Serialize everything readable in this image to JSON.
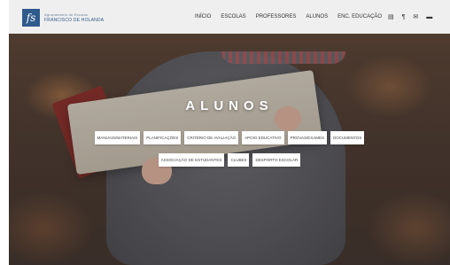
{
  "header": {
    "logo_letter": "fs",
    "logo_line1": "Agrupamento de Escolas",
    "logo_line2": "FRANCISCO DE HOLANDA",
    "nav_items": [
      "INÍCIO",
      "ESCOLAS",
      "PROFESSORES",
      "ALUNOS",
      "ENC. EDUCAÇÃO"
    ],
    "icons": [
      {
        "name": "document-icon",
        "glyph": "▤"
      },
      {
        "name": "restaurant-icon",
        "glyph": "¶"
      },
      {
        "name": "email-icon",
        "glyph": "✉"
      },
      {
        "name": "envelope-icon",
        "glyph": "▬"
      }
    ]
  },
  "hero": {
    "title": "ALUNOS",
    "buttons_row1": [
      "MANUAIS/MATERIAIS",
      "PLANIFICAÇÕES",
      "CRITÉRIO DE AVALIAÇÃO",
      "APOIO EDUCATIVO",
      "PROVAS/EXAMES",
      "DOCUMENTOS"
    ],
    "buttons_row2": [
      "ASSOCIAÇÃO DE ESTUDANTES",
      "CLUBES",
      "DESPORTO ESCOLAR"
    ]
  },
  "colors": {
    "brand": "#2f5a8c",
    "topbar": "#efefef",
    "button_bg": "#ffffff"
  }
}
